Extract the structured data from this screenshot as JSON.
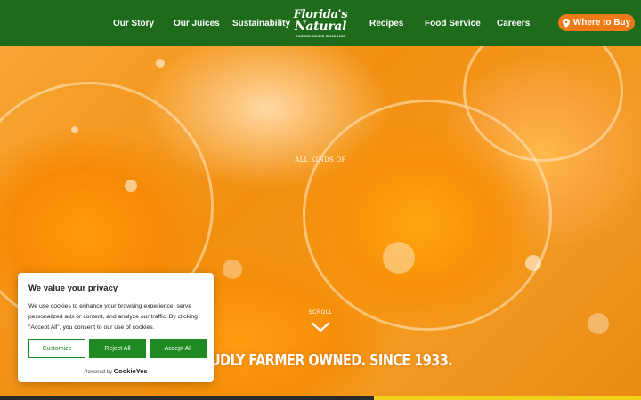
{
  "header": {
    "nav_left": [
      "Our Story",
      "Our Juices",
      "Sustainability"
    ],
    "nav_right": [
      "Recipes",
      "Food Service",
      "Careers"
    ],
    "logo": {
      "line1": "Florida's",
      "line2": "Natural",
      "tagline": "FARMER-OWNED SINCE 1933"
    },
    "where_to_buy": "Where to Buy",
    "colors": {
      "header_bg": "#1f6b1c",
      "accent": "#f07b16"
    }
  },
  "hero": {
    "eyebrow": "ALL KINDS OF",
    "scroll_label": "SCROLL",
    "tagline": "UDLY FARMER OWNED. SINCE 1933.",
    "background": "orange-slices-splash"
  },
  "cookie": {
    "title": "We value your privacy",
    "text": "We use cookies to enhance your browsing experience, serve personalized ads or content, and analyze our traffic. By clicking \"Accept All\", you consent to our use of cookies.",
    "customize": "Customize",
    "reject": "Reject All",
    "accept": "Accept All",
    "powered_by": "Powered by",
    "brand": "CookieYes",
    "accent": "#1e8a21"
  }
}
